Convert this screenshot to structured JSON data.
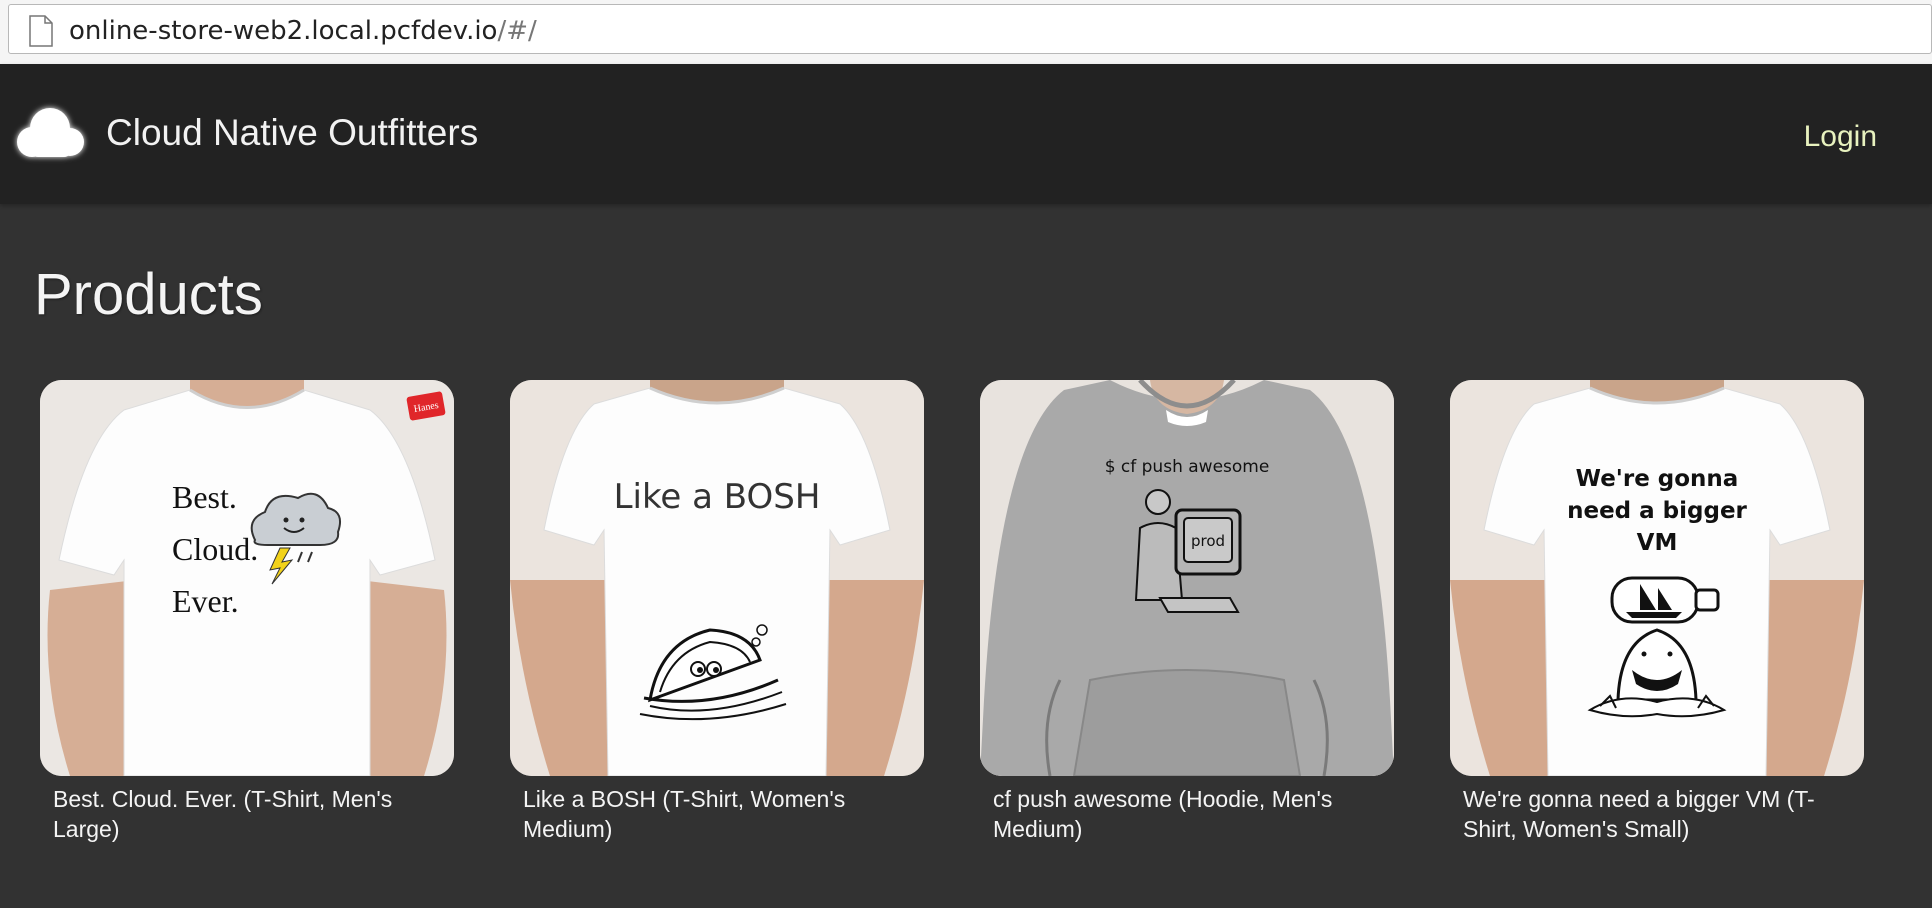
{
  "browser": {
    "url_main": "online-store-web2.local.pcfdev.io",
    "url_fragment": "/#/"
  },
  "navbar": {
    "brand": "Cloud Native Outfitters",
    "login_label": "Login",
    "logo_icon": "cloud-icon"
  },
  "main": {
    "title": "Products",
    "products": [
      {
        "name": "Best. Cloud. Ever. (T-Shirt, Men's Large)",
        "garment": "t-shirt",
        "shirt_color": "#ffffff"
      },
      {
        "name": "Like a BOSH (T-Shirt, Women's Medium)",
        "garment": "t-shirt",
        "shirt_color": "#ffffff"
      },
      {
        "name": "cf push awesome (Hoodie, Men's Medium)",
        "garment": "hoodie",
        "shirt_color": "#a9a9a9"
      },
      {
        "name": "We're gonna need a bigger VM (T-Shirt, Women's Small)",
        "garment": "t-shirt",
        "shirt_color": "#ffffff"
      }
    ],
    "print_text": {
      "p1_line1": "Best.",
      "p1_line2": "Cloud.",
      "p1_line3": "Ever.",
      "p1_tag": "Hanes",
      "p2_line1": "Like a BOSH",
      "p3_line1": "$ cf push awesome",
      "p3_screen": "prod",
      "p4_line1": "We're gonna",
      "p4_line2": "need a bigger",
      "p4_line3": "VM"
    }
  },
  "colors": {
    "navbar_bg": "#222222",
    "page_bg": "#323232",
    "login_link": "#e8f2bf"
  }
}
